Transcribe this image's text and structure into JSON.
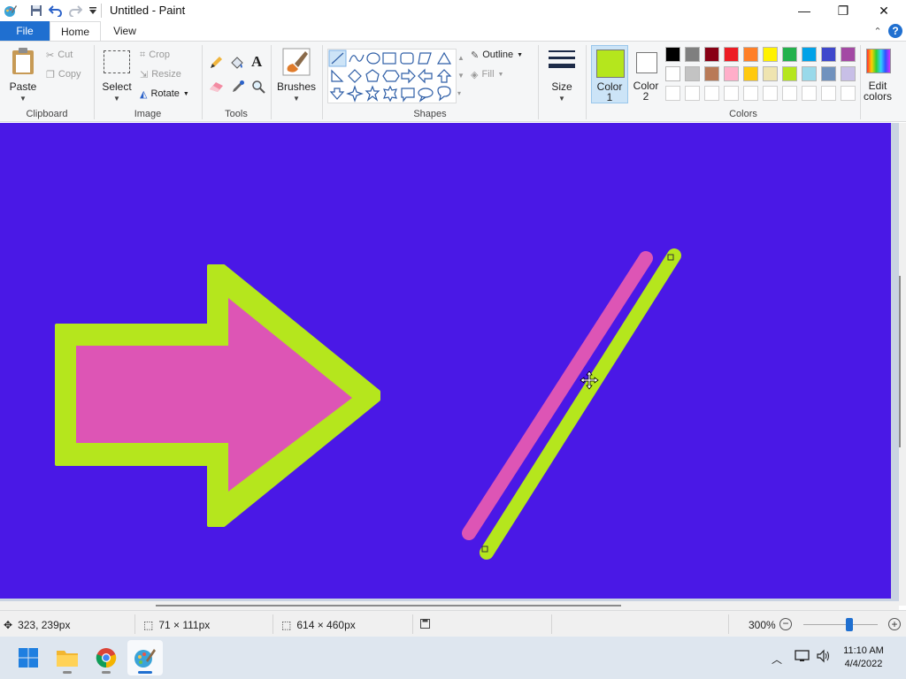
{
  "app": {
    "title": "Untitled - Paint"
  },
  "titlebar": {
    "minimize": "—",
    "maximize": "❐",
    "close": "✕"
  },
  "tabs": [
    {
      "label": "File"
    },
    {
      "label": "Home"
    },
    {
      "label": "View"
    }
  ],
  "help_label": "?",
  "ribbon": {
    "clipboard": {
      "label": "Clipboard",
      "paste": "Paste",
      "cut": "Cut",
      "copy": "Copy"
    },
    "image": {
      "label": "Image",
      "select": "Select",
      "crop": "Crop",
      "resize": "Resize",
      "rotate": "Rotate"
    },
    "tools": {
      "label": "Tools",
      "text_glyph": "A"
    },
    "brushes": {
      "label": "Brushes"
    },
    "shapes": {
      "label": "Shapes",
      "outline": "Outline",
      "fill": "Fill"
    },
    "size": {
      "label": "Size"
    },
    "colors": {
      "label": "Colors",
      "color1_line1": "Color",
      "color1_line2": "1",
      "color2_line1": "Color",
      "color2_line2": "2",
      "edit_line1": "Edit",
      "edit_line2": "colors",
      "color1_value": "#b5e61d",
      "color2_value": "#ffffff",
      "palette_row1": [
        "#000000",
        "#7f7f7f",
        "#880015",
        "#ed1c24",
        "#ff7f27",
        "#fff200",
        "#22b14c",
        "#00a2e8",
        "#3f48cc",
        "#a349a4"
      ],
      "palette_row2": [
        "#ffffff",
        "#c3c3c3",
        "#b97a57",
        "#ffaec9",
        "#ffc90e",
        "#efe4b0",
        "#b5e61d",
        "#99d9ea",
        "#7092be",
        "#c8bfe7"
      ],
      "palette_row3": [
        "#ffffff",
        "#ffffff",
        "#ffffff",
        "#ffffff",
        "#ffffff",
        "#ffffff",
        "#ffffff",
        "#ffffff",
        "#ffffff",
        "#ffffff"
      ]
    }
  },
  "canvas": {
    "background": "#4a18e6",
    "arrow_fill": "#dd55b5",
    "arrow_outline": "#b5e61d"
  },
  "statusbar": {
    "cursor_pos": "323, 239px",
    "selection_size": "71 × 111px",
    "image_size": "614 × 460px",
    "zoom": "300%",
    "zoom_slider_fraction": 0.62
  },
  "taskbar": {
    "time": "11:10 AM",
    "date": "4/4/2022"
  }
}
